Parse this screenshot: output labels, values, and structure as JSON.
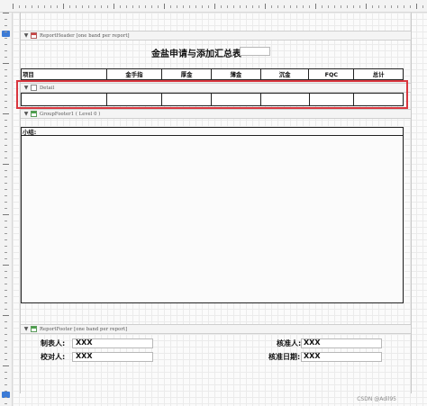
{
  "report": {
    "title": "金盐申请与添加汇总表",
    "bands": {
      "report_header": "ReportHeader [one band per report]",
      "detail": "Detail",
      "group_footer": "GroupFooter1 ( Level 0 )",
      "report_footer": "ReportFooter [one band per report]"
    },
    "columns": [
      "项目",
      "金手指",
      "厚金",
      "薄金",
      "沉金",
      "FQC",
      "总计"
    ],
    "group_footer_label": "小结:",
    "footer": {
      "prepared_by_label": "制表人:",
      "prepared_by_value": "XXX",
      "checked_by_label": "校对人:",
      "checked_by_value": "XXX",
      "approved_by_label": "核准人:",
      "approved_by_value": "XXX",
      "approved_date_label": "核准日期:",
      "approved_date_value": "XXX"
    }
  },
  "watermark": "CSDN @Adil95"
}
